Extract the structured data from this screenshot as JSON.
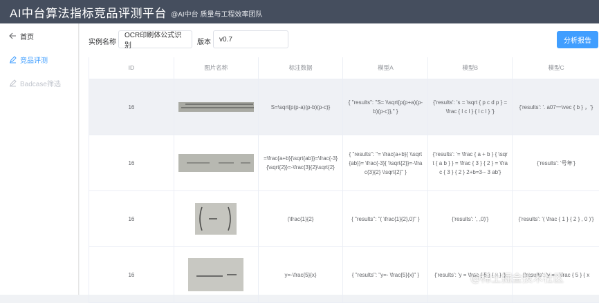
{
  "header": {
    "title": "AI中台算法指标竞品评测平台",
    "subtitle": "@AI中台 质量与工程效率团队"
  },
  "sidebar": {
    "items": [
      {
        "label": "首页",
        "icon": "arrow-left-icon"
      },
      {
        "label": "竞品评测",
        "icon": "edit-icon"
      },
      {
        "label": "Badcase筛选",
        "icon": "edit-icon"
      }
    ]
  },
  "toolbar": {
    "instance_label": "实例名称",
    "instance_value": "OCR印刷体公式识别",
    "version_label": "版本",
    "version_value": "v0.7",
    "report_button": "分析报告"
  },
  "table": {
    "columns": [
      "ID",
      "图片名称",
      "标注数据",
      "模型A",
      "模型B",
      "模型C"
    ],
    "rows": [
      {
        "id": "16",
        "label": "S=\\sqrt{p(p-a)(p-b)(p-c)}",
        "a": "{ \"results\": \"S= \\\\sqrt{p(p+a)(p-b)(p-c)},\" }",
        "b": "{'results': 's = \\sqrt { p c d p } = \\frac { l c l } { l c l } '}",
        "c": "{'results': '. a07一\\vec { b } ，'}"
      },
      {
        "id": "16",
        "label": "=\\frac{a+b}{\\sqrt{ab}}=\\frac{-3}{\\sqrt{2}}=-\\frac{3}{2}\\sqrt{2}",
        "a": "{ \"results\": \"= \\frac{a+b}{ \\\\sqrt{ab}}= \\frac{-3}{ \\\\sqrt{2}}=-\\frac{3}{2} \\\\sqrt{2}\" }",
        "b": "{'results': '= \\frac { a + b } { \\sqrt { a b } } = \\frac { 3 } { 2 } = \\frac { 3 } { 2 } 2+b=3-- 3 ab'}",
        "c": "{'results': '号年'}"
      },
      {
        "id": "16",
        "label": "(\\frac{1}{2}",
        "a": "{ \"results\": \"( \\frac{1}{2},0)\" }",
        "b": "{'results': ', ,0)'}",
        "c": "{'results': '( \\frac { 1 } { 2 } , 0 )'}"
      },
      {
        "id": "16",
        "label": "y=-\\frac{5}{x}",
        "a": "{ \"results\": \"y=- \\frac{5}{x}\" }",
        "b": "{'results': 'y = \\frac { 5 } { x } '}",
        "c": "{'results': 'y = - \\frac { 5 } { x"
      }
    ]
  },
  "watermark": "@稀土掘金技术社区"
}
